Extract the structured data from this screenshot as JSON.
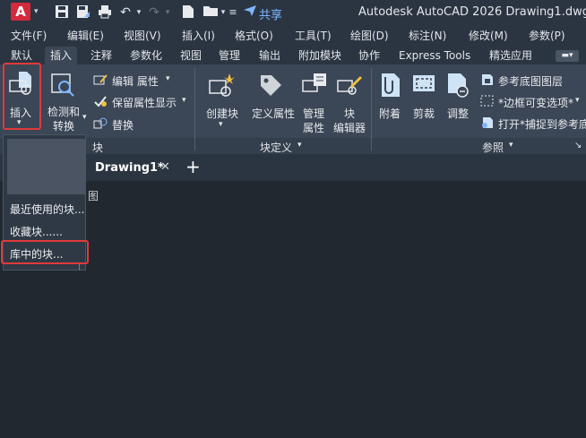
{
  "app": {
    "logo_letter": "A",
    "window_title": "Autodesk AutoCAD 2026    Drawing1.dwg"
  },
  "quick_access": {
    "share_label": "共享"
  },
  "menu": {
    "items": [
      "文件(F)",
      "编辑(E)",
      "视图(V)",
      "插入(I)",
      "格式(O)",
      "工具(T)",
      "绘图(D)",
      "标注(N)",
      "修改(M)",
      "参数(P)"
    ]
  },
  "ribbon_tabs": {
    "items": [
      "默认",
      "插入",
      "注释",
      "参数化",
      "视图",
      "管理",
      "输出",
      "附加模块",
      "协作",
      "Express Tools",
      "精选应用"
    ],
    "active": "插入"
  },
  "ribbon": {
    "block_panel": {
      "insert_label": "插入",
      "detect_label_1": "检测和",
      "detect_label_2": "转换",
      "edit_attr_label": "编辑 属性",
      "keep_attr_label": "保留属性显示",
      "replace_label": "替换",
      "title": "块"
    },
    "block_def_panel": {
      "create_label": "创建块",
      "define_attr_label": "定义属性",
      "manage_label_1": "管理",
      "manage_label_2": "属性",
      "editor_label_1": "块",
      "editor_label_2": "编辑器",
      "title": "块定义"
    },
    "reference_panel": {
      "attach_label": "附着",
      "clip_label": "剪裁",
      "adjust_label": "调整",
      "underlay_layers_label": "参考底图图层",
      "frame_label": "*边框可变选项*",
      "snap_label": "打开*捕捉到参考底",
      "title": "参照"
    }
  },
  "file_tab": {
    "label": "Drawing1*",
    "close": "✕",
    "new": "+"
  },
  "dropdown": {
    "items": [
      "最近使用的块...",
      "收藏块......",
      "库中的块..."
    ]
  },
  "canvas": {
    "partial_text": "图"
  },
  "colors": {
    "accent_red": "#e03a3a",
    "autocad_red": "#d42a3b",
    "share_blue": "#7fb6ff",
    "ribbon_bg": "#3b4656",
    "canvas_bg": "#212830"
  }
}
